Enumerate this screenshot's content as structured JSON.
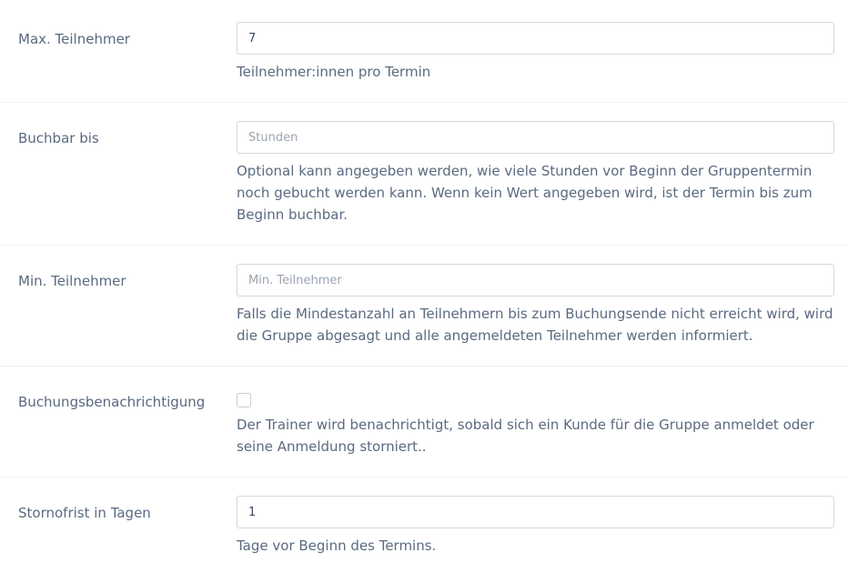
{
  "fields": [
    {
      "label": "Max. Teilnehmer",
      "value": "7",
      "placeholder": "",
      "help": "Teilnehmer:innen pro Termin"
    },
    {
      "label": "Buchbar bis",
      "value": "",
      "placeholder": "Stunden",
      "help": "Optional kann angegeben werden, wie viele Stunden vor Beginn der Gruppentermin noch gebucht werden kann. Wenn kein Wert angegeben wird, ist der Termin bis zum Beginn buchbar."
    },
    {
      "label": "Min. Teilnehmer",
      "value": "",
      "placeholder": "Min. Teilnehmer",
      "help": "Falls die Mindestanzahl an Teilnehmern bis zum Buchungsende nicht erreicht wird, wird die Gruppe abgesagt und alle angemeldeten Teilnehmer werden informiert."
    },
    {
      "label": "Buchungsbenachrichtigung",
      "checked": false,
      "help": "Der Trainer wird benachrichtigt, sobald sich ein Kunde für die Gruppe anmeldet oder seine Anmeldung storniert.."
    },
    {
      "label": "Stornofrist in Tagen",
      "value": "1",
      "placeholder": "",
      "help": "Tage vor Beginn des Termins."
    }
  ]
}
